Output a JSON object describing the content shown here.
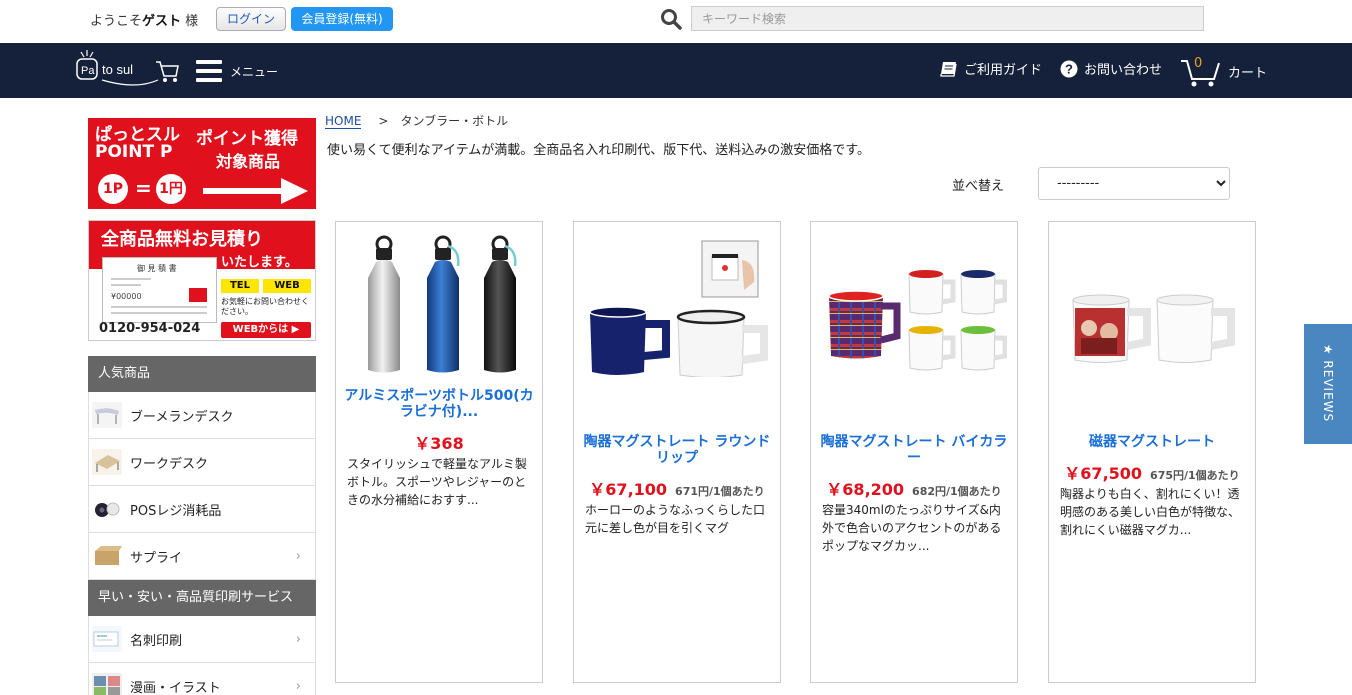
{
  "topbar": {
    "welcome_prefix": "ようこそ",
    "welcome_user": "ゲスト",
    "welcome_suffix": " 様",
    "login_label": "ログイン",
    "register_label": "会員登録(無料)",
    "search_placeholder": "キーワード検索"
  },
  "navbar": {
    "logo_text": "Pa to sul",
    "menu_label": "メニュー",
    "guide_label": "ご利用ガイド",
    "contact_label": "お問い合わせ",
    "cart_count": "0",
    "cart_label": "カート",
    "icons": [
      "menu-icon",
      "book-icon",
      "question-icon",
      "cart-icon"
    ]
  },
  "banners": {
    "points": {
      "line1": "ぱっとスル",
      "line2": "POINT P",
      "line3": "ポイント獲得",
      "line4": "対象商品",
      "coin1": "1P",
      "equals": "=",
      "coin2": "1円"
    },
    "estimate": {
      "heading": "全商品無料お見積り",
      "subheading": "いたします。",
      "doc_title": "御 見 積 書",
      "doc_amount": "¥00000",
      "tel": "TEL",
      "web": "WEB",
      "note": "お気軽にお問い合わせください。",
      "phone": "0120-954-024",
      "web_button": "WEBからは ▶"
    }
  },
  "sidebar": {
    "popular_header": "人気商品",
    "popular_items": [
      {
        "label": "ブーメランデスク",
        "has_chevron": false
      },
      {
        "label": "ワークデスク",
        "has_chevron": false
      },
      {
        "label": "POSレジ消耗品",
        "has_chevron": false
      },
      {
        "label": "サプライ",
        "has_chevron": true
      }
    ],
    "print_header": "早い・安い・高品質印刷サービス",
    "print_items": [
      {
        "label": "名刺印刷",
        "has_chevron": true
      },
      {
        "label": "漫画・イラスト",
        "has_chevron": true
      }
    ],
    "chevron": "›"
  },
  "main": {
    "breadcrumb": {
      "home": "HOME",
      "separator": ">",
      "current": "タンブラー・ボトル"
    },
    "description": "使い易くて便利なアイテムが満載。全商品名入れ印刷代、版下代、送料込みの激安価格です。",
    "sort_label": "並べ替え",
    "sort_value": "---------",
    "products": [
      {
        "title": "アルミスポーツボトル500(カラビナ付)...",
        "price": "￥368",
        "unit": "",
        "description": "スタイリッシュで軽量なアルミ製ボトル。スポーツやレジャーのときの水分補給におすす..."
      },
      {
        "title": "陶器マグストレート ラウンドリップ",
        "price": "￥67,100",
        "unit": "671円/1個あたり",
        "description": "ホーローのようなふっくらした口元に差し色が目を引くマグ"
      },
      {
        "title": "陶器マグストレート バイカラー",
        "price": "￥68,200",
        "unit": "682円/1個あたり",
        "description": "容量340mlのたっぷりサイズ&内外で色合いのアクセントのがあるポップなマグカッ..."
      },
      {
        "title": "磁器マグストレート",
        "price": "￥67,500",
        "unit": "675円/1個あたり",
        "description": "陶器よりも白く、割れにくい！透明感のある美しい白色が特徴な、割れにくい磁器マグカ..."
      }
    ]
  },
  "reviews_tab": {
    "label": "★ REVIEWS"
  },
  "colors": {
    "navy": "#15213a",
    "accent_blue": "#2196f3",
    "link_blue": "#1a6ed8",
    "price_red": "#e0101c",
    "sidebar_header": "#666666",
    "reviews_blue": "#4a86c0"
  }
}
